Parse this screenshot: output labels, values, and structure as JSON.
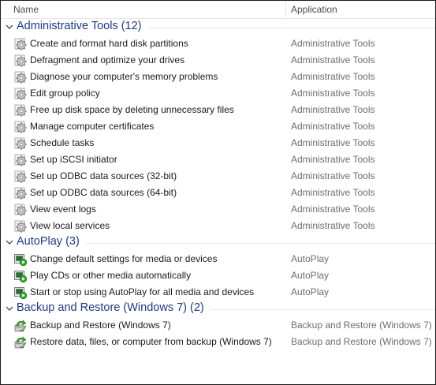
{
  "columns": {
    "name": "Name",
    "application": "Application"
  },
  "groups": [
    {
      "title": "Administrative Tools (12)",
      "icon": "admin-tools-gear-icon",
      "items": [
        {
          "label": "Create and format hard disk partitions",
          "app": "Administrative Tools"
        },
        {
          "label": "Defragment and optimize your drives",
          "app": "Administrative Tools"
        },
        {
          "label": "Diagnose your computer's memory problems",
          "app": "Administrative Tools"
        },
        {
          "label": "Edit group policy",
          "app": "Administrative Tools"
        },
        {
          "label": "Free up disk space by deleting unnecessary files",
          "app": "Administrative Tools"
        },
        {
          "label": "Manage computer certificates",
          "app": "Administrative Tools"
        },
        {
          "label": "Schedule tasks",
          "app": "Administrative Tools"
        },
        {
          "label": "Set up iSCSI initiator",
          "app": "Administrative Tools"
        },
        {
          "label": "Set up ODBC data sources (32-bit)",
          "app": "Administrative Tools"
        },
        {
          "label": "Set up ODBC data sources (64-bit)",
          "app": "Administrative Tools"
        },
        {
          "label": "View event logs",
          "app": "Administrative Tools"
        },
        {
          "label": "View local services",
          "app": "Administrative Tools"
        }
      ]
    },
    {
      "title": "AutoPlay (3)",
      "icon": "autoplay-icon",
      "items": [
        {
          "label": "Change default settings for media or devices",
          "app": "AutoPlay"
        },
        {
          "label": "Play CDs or other media automatically",
          "app": "AutoPlay"
        },
        {
          "label": "Start or stop using AutoPlay for all media and devices",
          "app": "AutoPlay"
        }
      ]
    },
    {
      "title": "Backup and Restore (Windows 7) (2)",
      "icon": "backup-restore-icon",
      "items": [
        {
          "label": "Backup and Restore (Windows 7)",
          "app": "Backup and Restore (Windows 7)"
        },
        {
          "label": "Restore data, files, or computer from backup (Windows 7)",
          "app": "Backup and Restore (Windows 7)"
        }
      ]
    }
  ]
}
